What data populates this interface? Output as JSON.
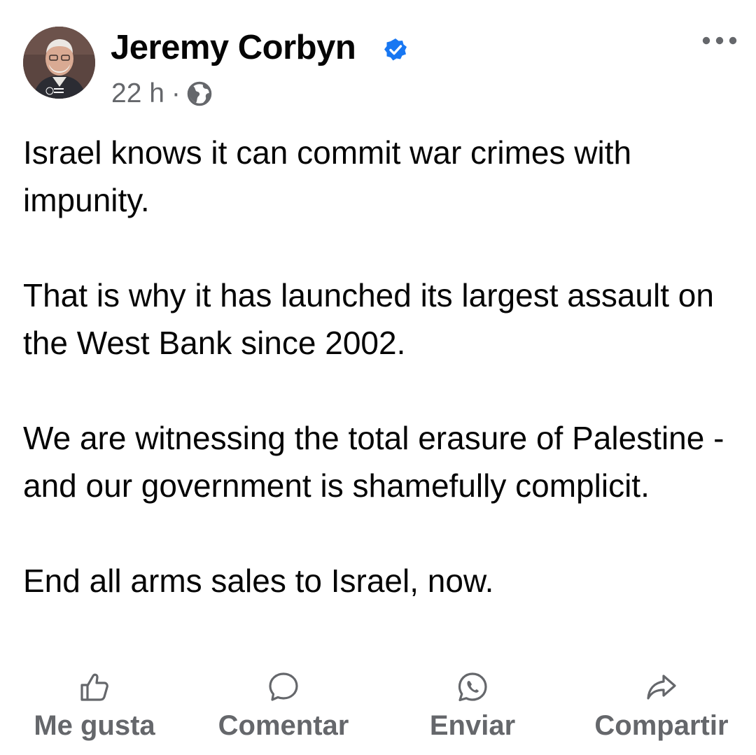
{
  "post": {
    "author": "Jeremy Corbyn",
    "time": "22 h",
    "separator": "·",
    "paragraphs": [
      "Israel knows it can commit war crimes with impunity.",
      "That is why it has launched its largest assault on the West Bank since 2002.",
      "We are witnessing the total erasure of Palestine - and our government is shamefully complicit.",
      "End all arms sales to Israel, now."
    ]
  },
  "actions": {
    "like": "Me gusta",
    "comment": "Comentar",
    "send": "Enviar",
    "share": "Compartir"
  },
  "icons": {
    "verified": "verified-badge-icon",
    "audience": "globe-icon",
    "more": "more-options-icon"
  },
  "colors": {
    "verified": "#1877f2",
    "secondary_text": "#65676b",
    "primary_text": "#050505"
  }
}
